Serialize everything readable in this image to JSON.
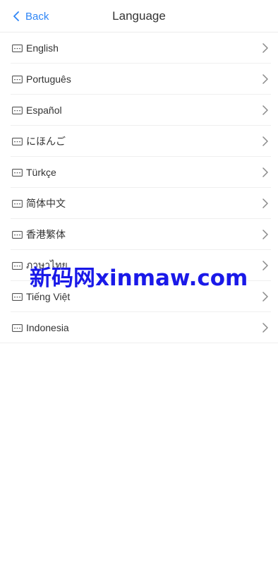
{
  "header": {
    "back_label": "Back",
    "title": "Language"
  },
  "languages": [
    {
      "label": "English"
    },
    {
      "label": "Português"
    },
    {
      "label": "Español"
    },
    {
      "label": "にほんご"
    },
    {
      "label": "Türkçe"
    },
    {
      "label": "简体中文"
    },
    {
      "label": "香港繁体"
    },
    {
      "label": "ภาษาไทย"
    },
    {
      "label": "Tiếng Việt"
    },
    {
      "label": "Indonesia"
    }
  ],
  "watermark": {
    "text": "新码网xinmaw.com"
  },
  "colors": {
    "accent": "#2f86f6",
    "watermark": "#1a19e8",
    "text": "#333333",
    "divider": "#efefef"
  },
  "icons": {
    "back": "chevron-left-icon",
    "row_leading": "keyboard-icon",
    "row_trailing": "chevron-right-icon"
  }
}
